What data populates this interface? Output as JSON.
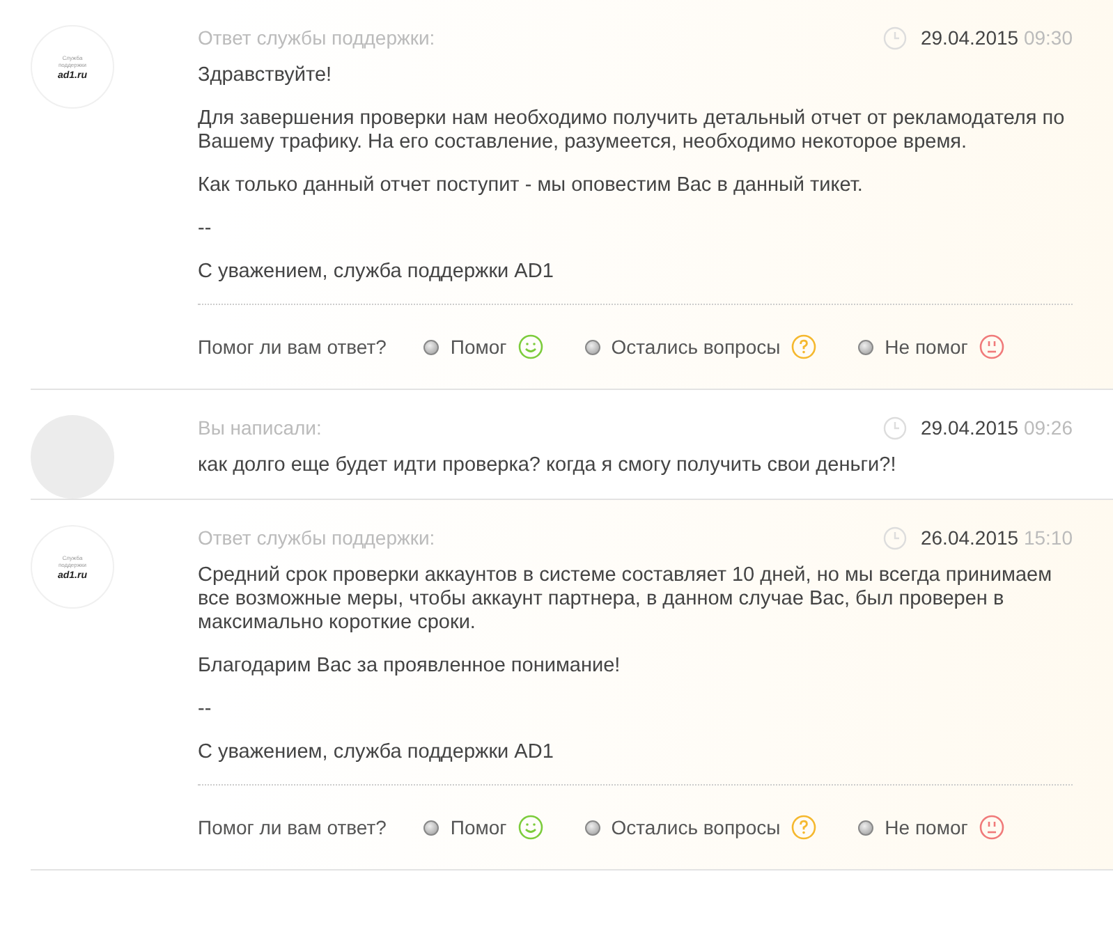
{
  "messages": [
    {
      "kind": "support",
      "avatar": {
        "kind": "logo",
        "line_1": "Служба",
        "line_2": "поддержки",
        "brand": "ad1.ru"
      },
      "author": "Ответ службы поддержки:",
      "date": "29.04.2015",
      "time": "09:30",
      "paragraphs": [
        "Здравствуйте!",
        "Для завершения проверки нам необходимо получить детальный отчет от рекламодателя по Вашему трафику. На его составление, разумеется, необходимо некоторое время.",
        "Как только данный отчет поступит - мы оповестим Вас в данный тикет.",
        "--",
        "С уважением, служба поддержки AD1"
      ],
      "feedback": {
        "question": "Помог ли вам ответ?",
        "options": [
          {
            "label": "Помог",
            "kind": "happy",
            "selected": false
          },
          {
            "label": "Остались вопросы",
            "kind": "question",
            "selected": false
          },
          {
            "label": "Не помог",
            "kind": "sad",
            "selected": false
          }
        ]
      }
    },
    {
      "kind": "user",
      "avatar": {
        "kind": "blank"
      },
      "author": "Вы написали:",
      "date": "29.04.2015",
      "time": "09:26",
      "paragraphs": [
        "как долго еще будет идти проверка? когда я смогу получить свои деньги?!"
      ]
    },
    {
      "kind": "support",
      "avatar": {
        "kind": "logo",
        "line_1": "Служба",
        "line_2": "поддержки",
        "brand": "ad1.ru"
      },
      "author": "Ответ службы поддержки:",
      "date": "26.04.2015",
      "time": "15:10",
      "paragraphs": [
        "Средний срок проверки аккаунтов в системе составляет 10 дней, но мы всегда принимаем все возможные меры, чтобы аккаунт партнера, в данном случае Вас, был проверен в максимально короткие сроки.",
        "Благодарим Вас за проявленное понимание!",
        "--",
        "С уважением, служба поддержки AD1"
      ],
      "feedback": {
        "question": "Помог ли вам ответ?",
        "options": [
          {
            "label": "Помог",
            "kind": "happy",
            "selected": false
          },
          {
            "label": "Остались вопросы",
            "kind": "question",
            "selected": false
          },
          {
            "label": "Не помог",
            "kind": "sad",
            "selected": false
          }
        ]
      }
    }
  ]
}
